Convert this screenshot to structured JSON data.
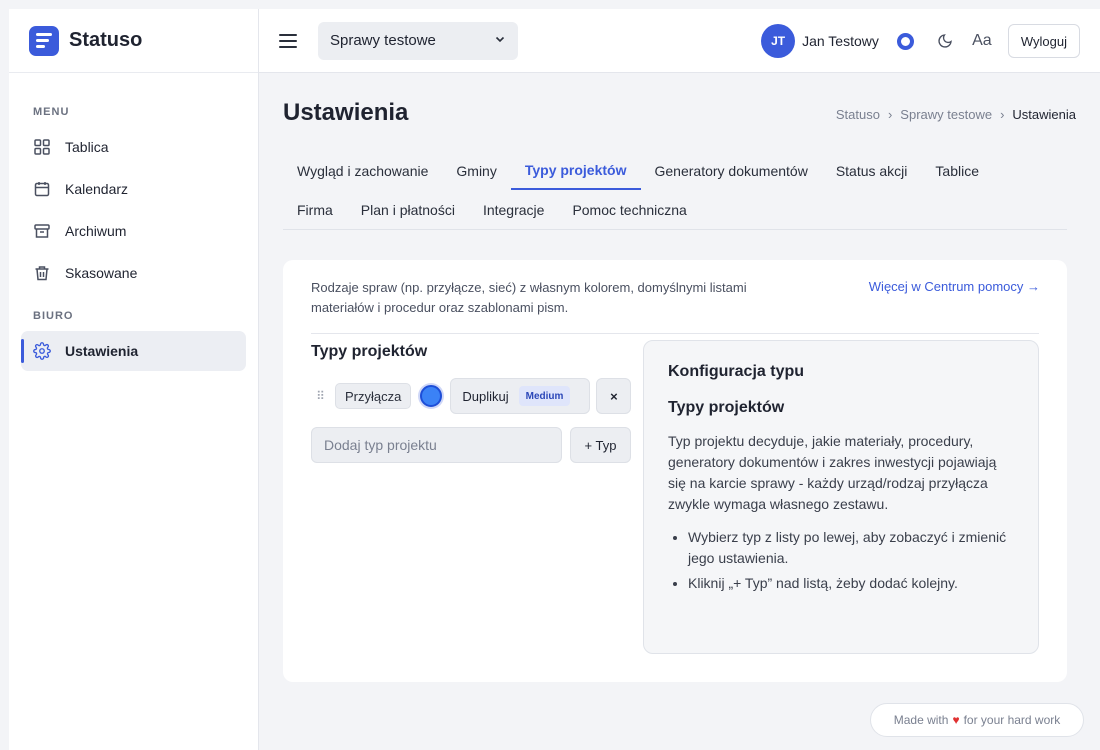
{
  "brand": {
    "name": "Statuso"
  },
  "sidebar": {
    "menu_label": "MENU",
    "menu_items": [
      {
        "label": "Tablica",
        "icon": "grid-icon"
      },
      {
        "label": "Kalendarz",
        "icon": "calendar-icon"
      },
      {
        "label": "Archiwum",
        "icon": "archive-icon"
      },
      {
        "label": "Skasowane",
        "icon": "trash-icon"
      }
    ],
    "biuro_label": "BIURO",
    "biuro_items": [
      {
        "label": "Ustawienia",
        "icon": "gear-icon",
        "active": true
      }
    ]
  },
  "header": {
    "case_select": "Sprawy testowe",
    "user_initials": "JT",
    "user_name": "Jan Testowy",
    "font_size_label": "Aa",
    "logout_label": "Wyloguj"
  },
  "main": {
    "title": "Ustawienia",
    "breadcrumb": [
      "Statuso",
      "›",
      "Sprawy testowe",
      "›",
      "Ustawienia"
    ],
    "tabs_row1": [
      "Wygląd i zachowanie",
      "Gminy",
      "Typy projektów",
      "Generatory dokumentów",
      "Status akcji",
      "Tablice"
    ],
    "tabs_row2": [
      "Firma",
      "Plan i płatności",
      "Integracje",
      "Pomoc techniczna"
    ],
    "active_tab": "Typy projektów",
    "intro": "Rodzaje spraw (np. przyłącze, sieć) z własnym kolorem, domyślnymi listami materiałów i procedur oraz szablonami pism.",
    "help_link": "Więcej w Centrum pomocy →",
    "section_title": "Typy projektów",
    "type_item": {
      "name": "Przyłącza",
      "color": "#3b82f6",
      "duplicate_label": "Duplikuj",
      "badge": "Medium",
      "remove_label": "×"
    },
    "add_placeholder": "Dodaj typ projektu",
    "add_button": "+ Typ",
    "config": {
      "title": "Konfiguracja typu",
      "subtitle": "Typy projektów",
      "description": "Typ projektu decyduje, jakie materiały, procedury, generatory dokumentów i zakres inwestycji pojawiają się na karcie sprawy - każdy urząd/rodzaj przyłącza zwykle wymaga własnego zestawu.",
      "tips": [
        "Wybierz typ z listy po lewej, aby zobaczyć i zmienić jego ustawienia.",
        "Kliknij „+ Typ” nad listą, żeby dodać kolejny."
      ]
    }
  },
  "footer": {
    "made_with": "Made with",
    "heart": "♥",
    "rest": "for your hard work"
  },
  "colors": {
    "accent": "#3b5bdb",
    "background": "#f3f4f7"
  }
}
